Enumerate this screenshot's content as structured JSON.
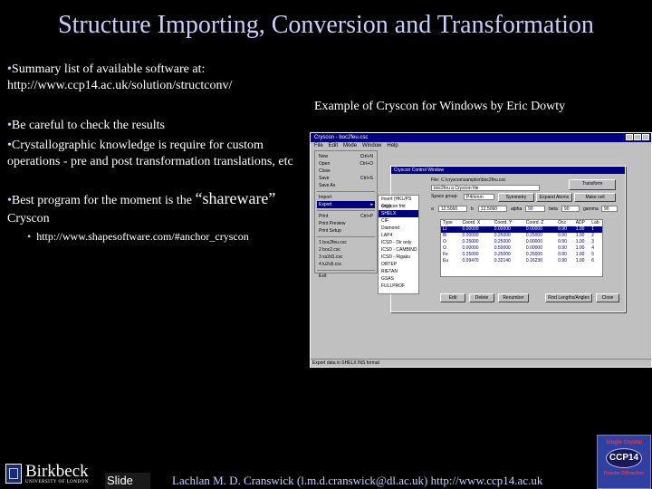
{
  "title": "Structure Importing, Conversion and Transformation",
  "bullets": {
    "summary": "Summary list of available software at:",
    "summary_url": "http://www.ccp14.ac.uk/solution/structconv/",
    "example_caption": "Example of Cryscon for Windows by Eric Dowty",
    "careful": "Be careful to check the results",
    "knowledge": "Crystallographic knowledge is require for custom operations - pre and post transformation translations, etc",
    "best_prefix": "Best program for the moment is the",
    "best_quote": "“shareware”",
    "best_suffix": "Cryscon",
    "sub_url": "http://www.shapesoftware.com/#anchor_cryscon"
  },
  "screenshot": {
    "window_title": "Cryscon - boc2feu.csc",
    "menus": [
      "File",
      "Edit",
      "Mode",
      "Window",
      "Help"
    ],
    "file_menu": [
      {
        "label": "New",
        "shortcut": "Ctrl+N"
      },
      {
        "label": "Open",
        "shortcut": "Ctrl+O"
      },
      {
        "label": "Close",
        "shortcut": ""
      },
      {
        "label": "Save",
        "shortcut": "Ctrl+S"
      },
      {
        "label": "Save As",
        "shortcut": ""
      },
      {
        "label": "Import",
        "shortcut": ""
      },
      {
        "label": "Export",
        "shortcut": ""
      },
      {
        "label": "Print",
        "shortcut": "Ctrl+P"
      },
      {
        "label": "Print Preview",
        "shortcut": ""
      },
      {
        "label": "Print Setup",
        "shortcut": ""
      },
      {
        "label": "1 boc2feu.csc",
        "shortcut": ""
      },
      {
        "label": "2 boc2.csc",
        "shortcut": ""
      },
      {
        "label": "3 ss2d1.csc",
        "shortcut": ""
      },
      {
        "label": "4 lu2o5.csc",
        "shortcut": ""
      },
      {
        "label": "Exit",
        "shortcut": ""
      }
    ],
    "export_submenu": [
      "Insert (HKL/PS only)",
      "Cryscon fmt",
      "SHELX",
      "CIF",
      "Diamond",
      "LAP4",
      "ICSD - Dir only",
      "ICSD - CAMBIND",
      "ICSD - Rigaku",
      "ORTEP",
      "RIETAN",
      "GSAS",
      "FULLPROF"
    ],
    "dialog_title": "Cryscon Control Window",
    "file_label": "File: C:\\cryscon\\samples\\boc2feu.csc",
    "comment_value": "boc2feu a Cryscon file",
    "space_group_label": "Space group:",
    "space_group_value": "P4/nmm",
    "cell_a": "12.5060",
    "cell_b": "12.5060",
    "alpha": "90",
    "beta": "90",
    "gamma": "90",
    "buttons": {
      "transform": "Transform",
      "symmetry": "Symmetry",
      "expand_atoms": "Expand Atoms",
      "make_cell": "Make cell",
      "edit": "Edit",
      "delete": "Delete",
      "renumber": "Renumber",
      "find_angles": "Find Lengths/Angles",
      "close": "Close"
    },
    "table_headers": [
      "Type",
      "Coord. X",
      "Coord. Y",
      "Coord. Z",
      "Occ",
      "ADP",
      "Lab"
    ],
    "table_rows": [
      [
        "Li",
        "0.00000",
        "0.00000",
        "0.00000",
        "0.90",
        "1.00",
        "1"
      ],
      [
        "Bi",
        "0.00000",
        "0.25000",
        "0.25000",
        "0.90",
        "1.00",
        "2"
      ],
      [
        "O",
        "0.25000",
        "0.25000",
        "0.00000",
        "0.90",
        "1.00",
        "3"
      ],
      [
        "O",
        "0.00000",
        "0.50000",
        "0.00000",
        "0.90",
        "1.00",
        "4"
      ],
      [
        "Fe",
        "0.25000",
        "0.25000",
        "0.25000",
        "0.90",
        "1.00",
        "5"
      ],
      [
        "Eu",
        "0.09470",
        "0.32140",
        "0.16230",
        "0.90",
        "1.00",
        "6"
      ]
    ],
    "status_text": "Export data in SHELX INS format"
  },
  "footer": {
    "slide_label": "Slide",
    "author": "Lachlan M. D. Cranswick (l.m.d.cranswick@dl.ac.uk) http://www.ccp14.ac.uk"
  },
  "logos": {
    "birkbeck_name": "Birkbeck",
    "birkbeck_sub": "UNIVERSITY OF LONDON",
    "ccp_top": "Single Crystal",
    "ccp_mid": "CCP14",
    "ccp_bot": "Powder Diffraction"
  },
  "colors": {
    "background": "#000000",
    "heading": "#c5cfff",
    "text": "#ffffff",
    "window_title": "#000080"
  }
}
